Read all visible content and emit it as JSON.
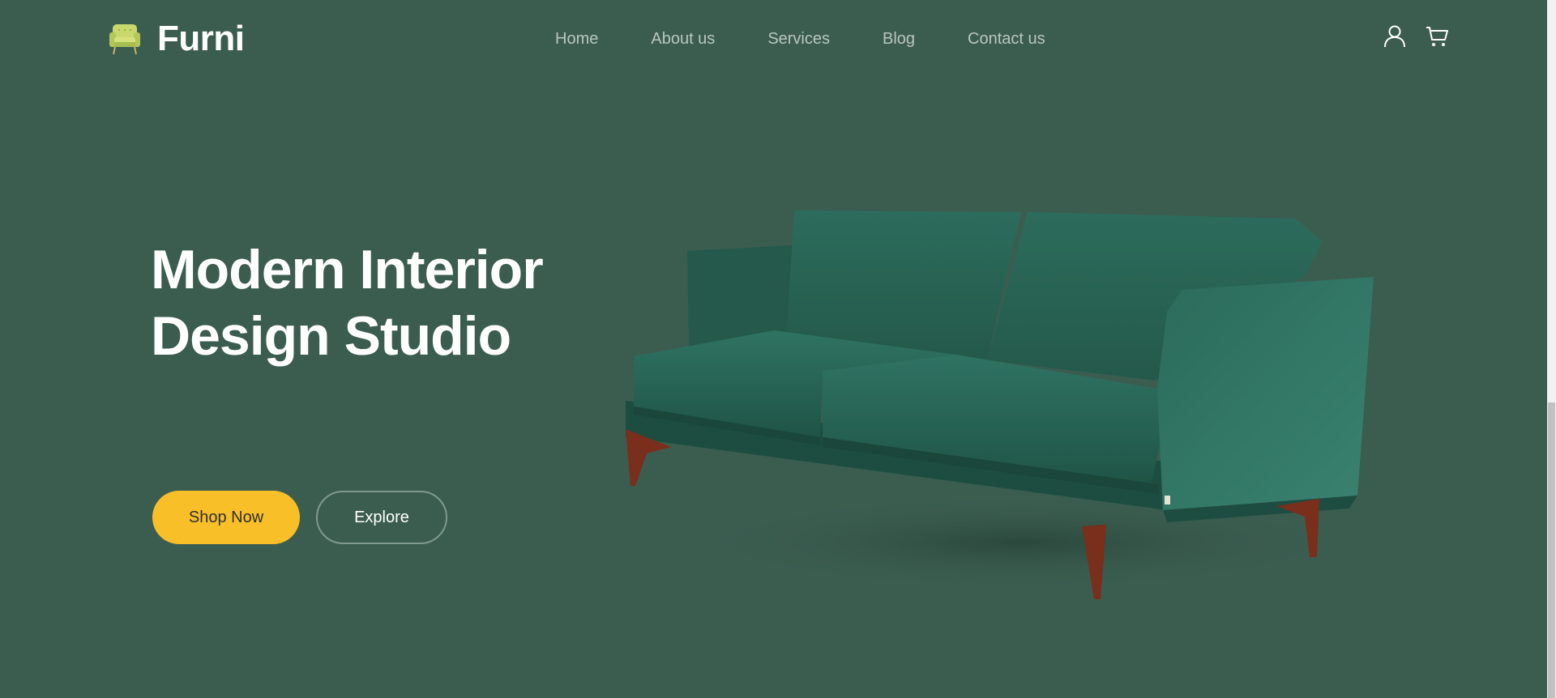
{
  "brand": {
    "name": "Furni",
    "icon": "armchair-icon"
  },
  "nav": {
    "items": [
      {
        "label": "Home"
      },
      {
        "label": "About us"
      },
      {
        "label": "Services"
      },
      {
        "label": "Blog"
      },
      {
        "label": "Contact us"
      }
    ]
  },
  "header_icons": {
    "user": "user-icon",
    "cart": "cart-icon"
  },
  "hero": {
    "title_line1": "Modern Interior",
    "title_line2": "Design Studio",
    "shop_label": "Shop Now",
    "explore_label": "Explore",
    "image": "green-velvet-sofa"
  },
  "colors": {
    "background": "#3b5d50",
    "accent": "#f9bf29",
    "nav_text": "#b9c6c0",
    "sofa": "#2f6f5d",
    "legs": "#7a2e1c"
  }
}
